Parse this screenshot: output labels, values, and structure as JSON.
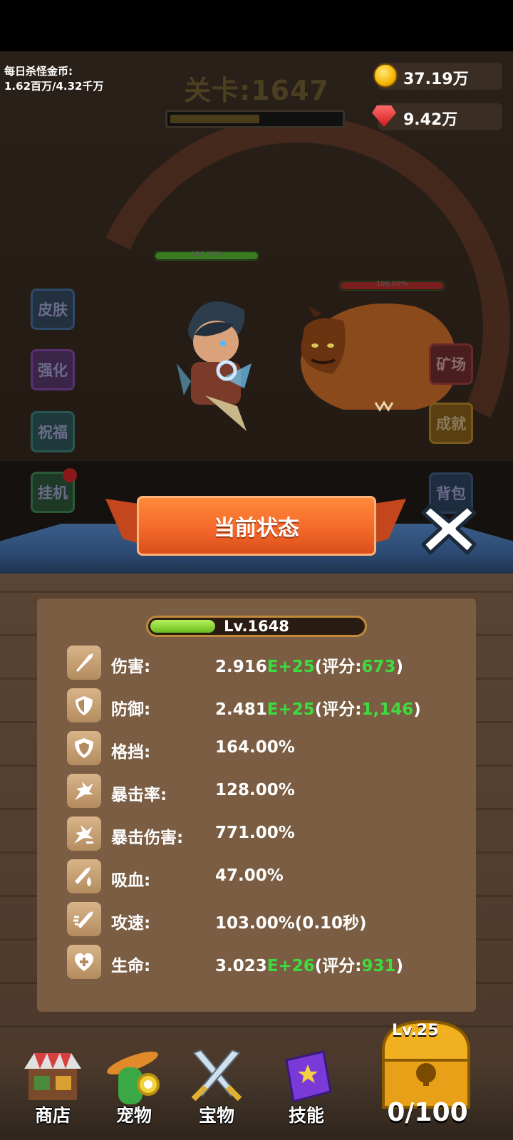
{
  "hud": {
    "daily_label": "每日杀怪金币:",
    "daily_value": "1.62百万/4.32千万",
    "stage_title": "关卡:1647",
    "stage_progress": 0.52,
    "gold": "37.19万",
    "gems": "9.42万"
  },
  "battle": {
    "hero_hp_text": "100.00%",
    "monster_hp_text": "100.00%",
    "hero_hp_color": "#3a7a22",
    "monster_hp_color": "#7a1f1f"
  },
  "side_buttons": {
    "left": [
      "皮肤",
      "强化",
      "祝福",
      "挂机"
    ],
    "right": [
      "矿场",
      "成就",
      "背包"
    ]
  },
  "panel": {
    "title": "当前状态",
    "level": "Lv.1648",
    "level_progress": 0.3,
    "stats": [
      {
        "label": "伤害:",
        "pre": "2.916",
        "exp": "E+25",
        "mid": "(评分:",
        "score": "673",
        "post": ")",
        "icon": "sword-icon"
      },
      {
        "label": "防御:",
        "pre": "2.481",
        "exp": "E+25",
        "mid": "(评分:",
        "score": "1,146",
        "post": ")",
        "icon": "shield-icon"
      },
      {
        "label": "格挡:",
        "pre": "164.00%",
        "icon": "block-shield-icon"
      },
      {
        "label": "暴击率:",
        "pre": "128.00%",
        "icon": "crit-burst-icon"
      },
      {
        "label": "暴击伤害:",
        "pre": "771.00%",
        "icon": "crit-damage-icon"
      },
      {
        "label": "吸血:",
        "pre": "47.00%",
        "icon": "lifesteal-icon"
      },
      {
        "label": "攻速:",
        "pre": "103.00%(0.10秒)",
        "icon": "attack-speed-icon"
      },
      {
        "label": "生命:",
        "pre": "3.023",
        "exp": "E+26",
        "mid": "(评分:",
        "score": "931",
        "post": ")",
        "icon": "heart-plus-icon"
      }
    ]
  },
  "bottom_nav": {
    "shop": "商店",
    "pet": "宠物",
    "treasure": "宝物",
    "skill": "技能",
    "chest_level": "Lv.25",
    "chest_count": "0/100"
  }
}
